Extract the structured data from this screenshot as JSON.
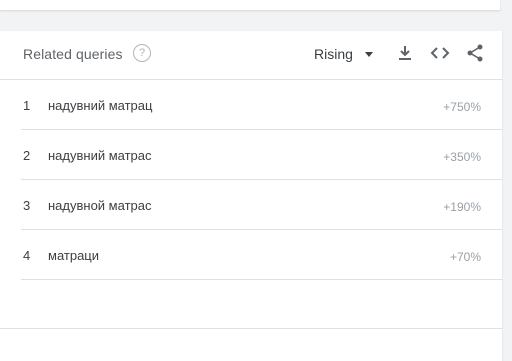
{
  "card": {
    "title": "Related queries",
    "help_icon": "?",
    "filter_label": "Rising",
    "icons": {
      "help": "help-circle-icon",
      "dropdown": "dropdown-arrow-icon",
      "download": "download-icon",
      "embed": "embed-code-icon",
      "share": "share-icon"
    }
  },
  "queries": [
    {
      "rank": "1",
      "query": "надувний матрац",
      "value": "+750%"
    },
    {
      "rank": "2",
      "query": "надувний матрас",
      "value": "+350%"
    },
    {
      "rank": "3",
      "query": "надувной матрас",
      "value": "+190%"
    },
    {
      "rank": "4",
      "query": "матраци",
      "value": "+70%"
    }
  ]
}
